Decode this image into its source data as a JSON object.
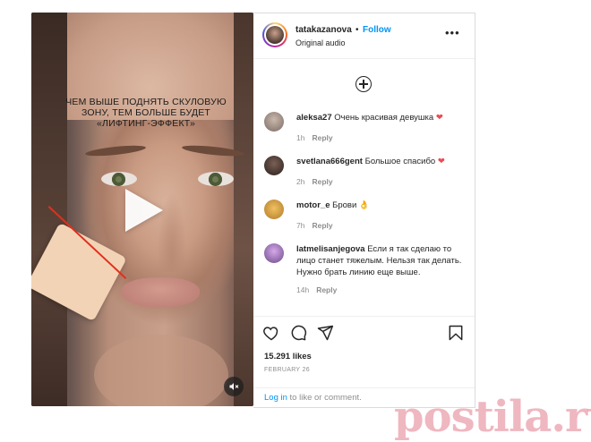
{
  "video": {
    "overlay_lines": [
      "ЧЕМ ВЫШЕ ПОДНЯТЬ СКУЛОВУЮ",
      "ЗОНУ, ТЕМ БОЛЬШЕ БУДЕТ",
      "«ЛИФТИНГ-ЭФФЕКТ»"
    ]
  },
  "header": {
    "username": "tatakazanova",
    "separator": "•",
    "follow_label": "Follow",
    "audio_label": "Original audio",
    "more_label": "•••"
  },
  "comments": [
    {
      "user": "aleksa27",
      "text": "Очень красивая девушка",
      "emoji": "❤",
      "time": "1h",
      "reply": "Reply",
      "avatar_color": "#8a7a70"
    },
    {
      "user": "svetlana666gent",
      "text": "Большое спасибо",
      "emoji": "❤",
      "time": "2h",
      "reply": "Reply",
      "avatar_color": "#3b2f2b"
    },
    {
      "user": "motor_e",
      "text": "Брови",
      "emoji": "👌",
      "time": "7h",
      "reply": "Reply",
      "avatar_color": "#d9a441"
    },
    {
      "user": "latmelisanjegova",
      "text": "Если я так сделаю то лицо станет тяжелым. Нельзя так делать. Нужно брать линию еще выше.",
      "emoji": "",
      "time": "14h",
      "reply": "Reply",
      "avatar_color": "#a070c0"
    }
  ],
  "stats": {
    "likes": "15.291 likes",
    "date": "FEBRUARY 26"
  },
  "login": {
    "link": "Log in",
    "rest": " to like or comment."
  },
  "watermark": "postila.ru",
  "colors": {
    "accent": "#0095f6",
    "heart": "#ed4956",
    "muted": "#8e8e8e"
  }
}
